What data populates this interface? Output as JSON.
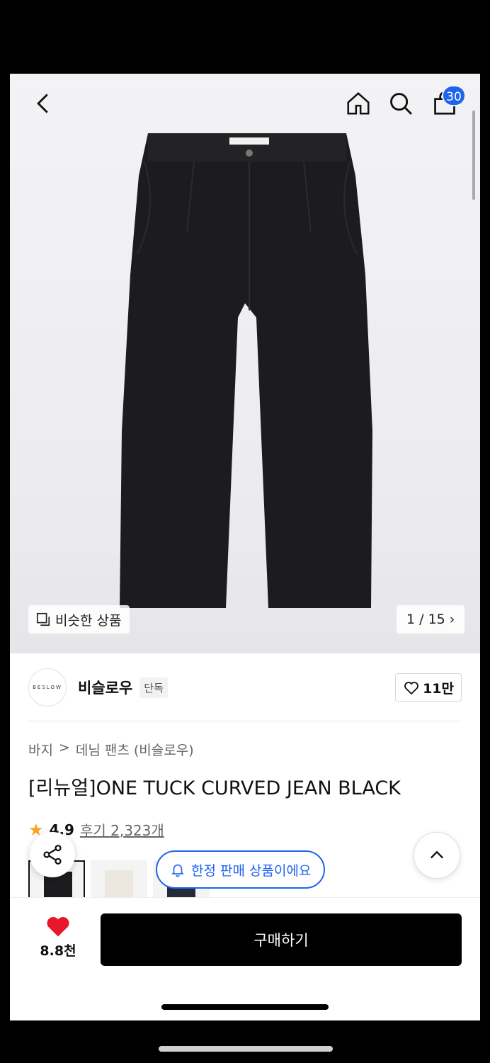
{
  "header": {
    "back_icon": "chevron-left-icon",
    "home_icon": "home-icon",
    "search_icon": "search-icon",
    "cart_icon": "shopping-bag-icon",
    "cart_count": "30"
  },
  "gallery": {
    "similar_label": "비슷한 상품",
    "pager": "1 / 15"
  },
  "brand": {
    "logo_text": "BESLOW",
    "name": "비슬로우",
    "badge": "단독",
    "likes": "11만"
  },
  "breadcrumb": {
    "category": "바지",
    "separator": ">",
    "subcategory": "데님 팬츠 (비슬로우)"
  },
  "product": {
    "title": "[리뉴얼]ONE TUCK CURVED JEAN BLACK",
    "rating": "4.9",
    "reviews": "후기 2,323개"
  },
  "floating": {
    "limited_label": "한정 판매 상품이에요"
  },
  "bottom": {
    "wish_count": "8.8천",
    "buy_label": "구매하기"
  },
  "colors": {
    "accent": "#1e63f0",
    "heart": "#e8172b",
    "star": "#f6a623",
    "buy_button": "#000000"
  }
}
